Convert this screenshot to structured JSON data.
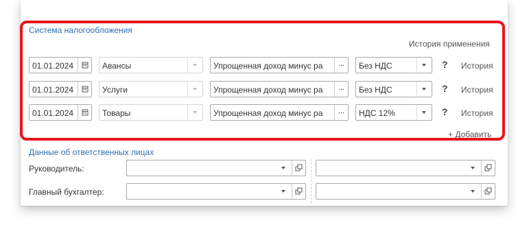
{
  "tax_system": {
    "title": "Система налогообложения",
    "history_link": "История применения",
    "rows": [
      {
        "date": "01.01.2024",
        "category": "Авансы",
        "regime": "Упрощенная доход минус ра",
        "vat": "Без НДС",
        "history": "История"
      },
      {
        "date": "01.01.2024",
        "category": "Услуги",
        "regime": "Упрощенная доход минус ра",
        "vat": "Без НДС",
        "history": "История"
      },
      {
        "date": "01.01.2024",
        "category": "Товары",
        "regime": "Упрощенная доход минус ра",
        "vat": "НДС 12%",
        "history": "История"
      }
    ],
    "help_symbol": "?",
    "dots_symbol": "...",
    "add_link": "+ Добавить"
  },
  "responsible": {
    "title": "Данные об ответственных лицах",
    "director_label": "Руководитель:",
    "accountant_label": "Главный бухгалтер:",
    "director_value": "",
    "director_value_2": "",
    "accountant_value": "",
    "accountant_value_2": ""
  },
  "colors": {
    "highlight_border": "#e8141c",
    "section_title": "#2f6db5"
  },
  "icons": [
    "calendar-icon",
    "chevron-down-icon",
    "ellipsis-icon",
    "help-icon",
    "open-icon"
  ]
}
